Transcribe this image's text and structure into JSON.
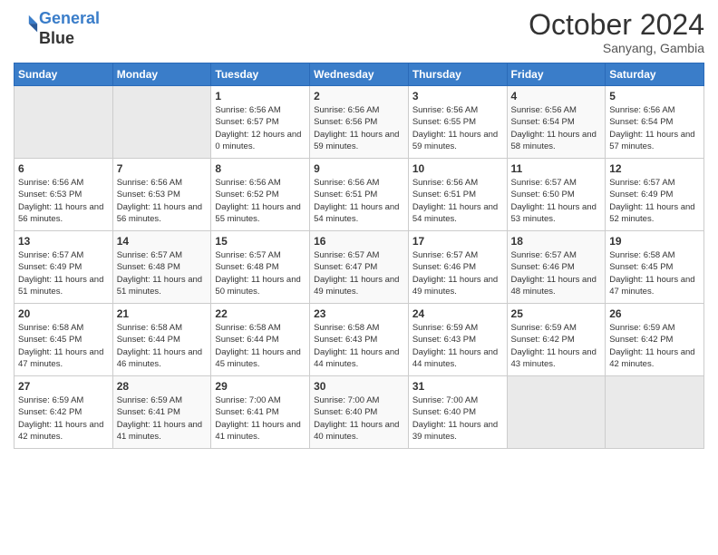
{
  "header": {
    "logo_line1": "General",
    "logo_line2": "Blue",
    "month": "October 2024",
    "location": "Sanyang, Gambia"
  },
  "days_of_week": [
    "Sunday",
    "Monday",
    "Tuesday",
    "Wednesday",
    "Thursday",
    "Friday",
    "Saturday"
  ],
  "weeks": [
    [
      {
        "day": "",
        "info": ""
      },
      {
        "day": "",
        "info": ""
      },
      {
        "day": "1",
        "info": "Sunrise: 6:56 AM\nSunset: 6:57 PM\nDaylight: 12 hours\nand 0 minutes."
      },
      {
        "day": "2",
        "info": "Sunrise: 6:56 AM\nSunset: 6:56 PM\nDaylight: 11 hours\nand 59 minutes."
      },
      {
        "day": "3",
        "info": "Sunrise: 6:56 AM\nSunset: 6:55 PM\nDaylight: 11 hours\nand 59 minutes."
      },
      {
        "day": "4",
        "info": "Sunrise: 6:56 AM\nSunset: 6:54 PM\nDaylight: 11 hours\nand 58 minutes."
      },
      {
        "day": "5",
        "info": "Sunrise: 6:56 AM\nSunset: 6:54 PM\nDaylight: 11 hours\nand 57 minutes."
      }
    ],
    [
      {
        "day": "6",
        "info": "Sunrise: 6:56 AM\nSunset: 6:53 PM\nDaylight: 11 hours\nand 56 minutes."
      },
      {
        "day": "7",
        "info": "Sunrise: 6:56 AM\nSunset: 6:53 PM\nDaylight: 11 hours\nand 56 minutes."
      },
      {
        "day": "8",
        "info": "Sunrise: 6:56 AM\nSunset: 6:52 PM\nDaylight: 11 hours\nand 55 minutes."
      },
      {
        "day": "9",
        "info": "Sunrise: 6:56 AM\nSunset: 6:51 PM\nDaylight: 11 hours\nand 54 minutes."
      },
      {
        "day": "10",
        "info": "Sunrise: 6:56 AM\nSunset: 6:51 PM\nDaylight: 11 hours\nand 54 minutes."
      },
      {
        "day": "11",
        "info": "Sunrise: 6:57 AM\nSunset: 6:50 PM\nDaylight: 11 hours\nand 53 minutes."
      },
      {
        "day": "12",
        "info": "Sunrise: 6:57 AM\nSunset: 6:49 PM\nDaylight: 11 hours\nand 52 minutes."
      }
    ],
    [
      {
        "day": "13",
        "info": "Sunrise: 6:57 AM\nSunset: 6:49 PM\nDaylight: 11 hours\nand 51 minutes."
      },
      {
        "day": "14",
        "info": "Sunrise: 6:57 AM\nSunset: 6:48 PM\nDaylight: 11 hours\nand 51 minutes."
      },
      {
        "day": "15",
        "info": "Sunrise: 6:57 AM\nSunset: 6:48 PM\nDaylight: 11 hours\nand 50 minutes."
      },
      {
        "day": "16",
        "info": "Sunrise: 6:57 AM\nSunset: 6:47 PM\nDaylight: 11 hours\nand 49 minutes."
      },
      {
        "day": "17",
        "info": "Sunrise: 6:57 AM\nSunset: 6:46 PM\nDaylight: 11 hours\nand 49 minutes."
      },
      {
        "day": "18",
        "info": "Sunrise: 6:57 AM\nSunset: 6:46 PM\nDaylight: 11 hours\nand 48 minutes."
      },
      {
        "day": "19",
        "info": "Sunrise: 6:58 AM\nSunset: 6:45 PM\nDaylight: 11 hours\nand 47 minutes."
      }
    ],
    [
      {
        "day": "20",
        "info": "Sunrise: 6:58 AM\nSunset: 6:45 PM\nDaylight: 11 hours\nand 47 minutes."
      },
      {
        "day": "21",
        "info": "Sunrise: 6:58 AM\nSunset: 6:44 PM\nDaylight: 11 hours\nand 46 minutes."
      },
      {
        "day": "22",
        "info": "Sunrise: 6:58 AM\nSunset: 6:44 PM\nDaylight: 11 hours\nand 45 minutes."
      },
      {
        "day": "23",
        "info": "Sunrise: 6:58 AM\nSunset: 6:43 PM\nDaylight: 11 hours\nand 44 minutes."
      },
      {
        "day": "24",
        "info": "Sunrise: 6:59 AM\nSunset: 6:43 PM\nDaylight: 11 hours\nand 44 minutes."
      },
      {
        "day": "25",
        "info": "Sunrise: 6:59 AM\nSunset: 6:42 PM\nDaylight: 11 hours\nand 43 minutes."
      },
      {
        "day": "26",
        "info": "Sunrise: 6:59 AM\nSunset: 6:42 PM\nDaylight: 11 hours\nand 42 minutes."
      }
    ],
    [
      {
        "day": "27",
        "info": "Sunrise: 6:59 AM\nSunset: 6:42 PM\nDaylight: 11 hours\nand 42 minutes."
      },
      {
        "day": "28",
        "info": "Sunrise: 6:59 AM\nSunset: 6:41 PM\nDaylight: 11 hours\nand 41 minutes."
      },
      {
        "day": "29",
        "info": "Sunrise: 7:00 AM\nSunset: 6:41 PM\nDaylight: 11 hours\nand 41 minutes."
      },
      {
        "day": "30",
        "info": "Sunrise: 7:00 AM\nSunset: 6:40 PM\nDaylight: 11 hours\nand 40 minutes."
      },
      {
        "day": "31",
        "info": "Sunrise: 7:00 AM\nSunset: 6:40 PM\nDaylight: 11 hours\nand 39 minutes."
      },
      {
        "day": "",
        "info": ""
      },
      {
        "day": "",
        "info": ""
      }
    ]
  ]
}
